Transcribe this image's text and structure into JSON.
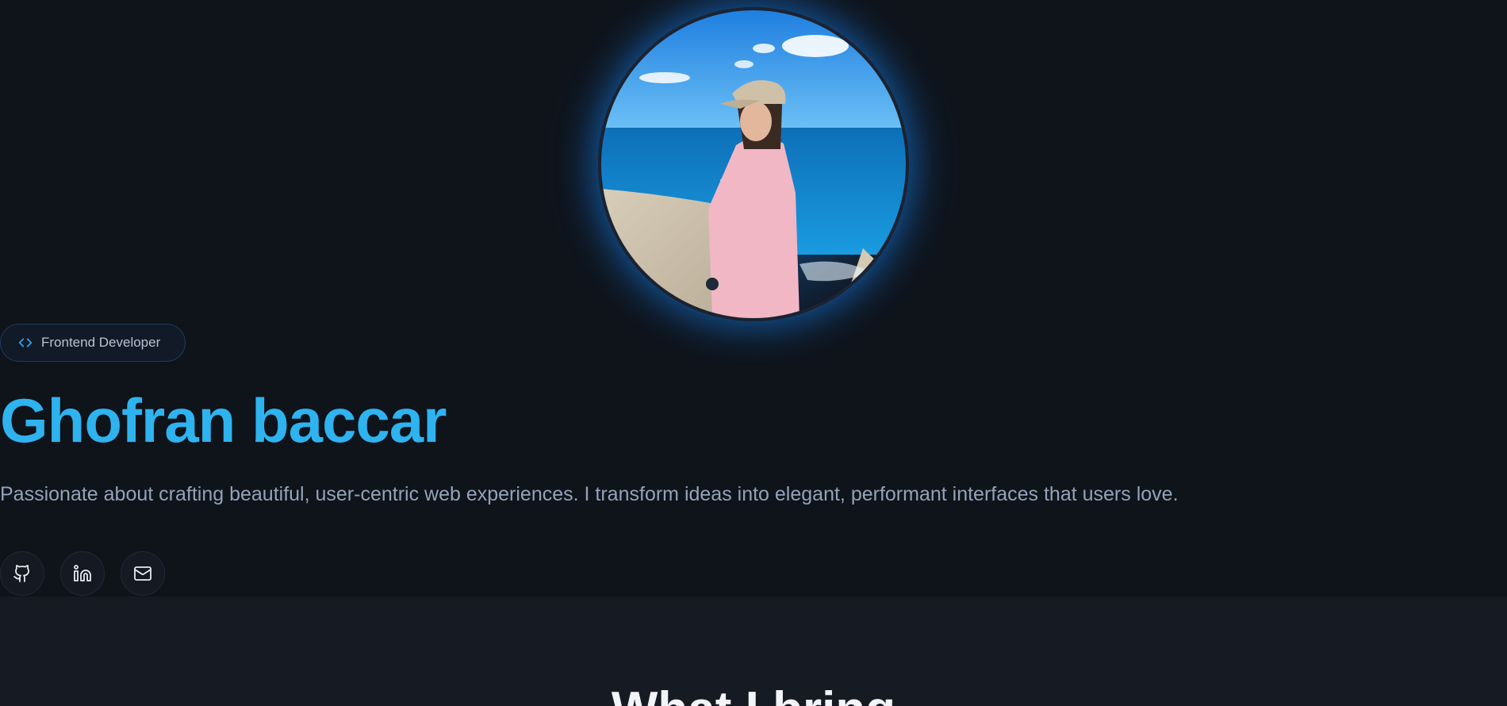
{
  "profile": {
    "photo_alt": "Profile photo"
  },
  "hero": {
    "role_badge": "Frontend Developer",
    "name": "Ghofran baccar",
    "bio": "Passionate about crafting beautiful, user-centric web experiences. I transform ideas into elegant, performant interfaces that users love."
  },
  "socials": [
    {
      "icon": "github-icon",
      "label": "GitHub"
    },
    {
      "icon": "linkedin-icon",
      "label": "LinkedIn"
    },
    {
      "icon": "mail-icon",
      "label": "Email"
    }
  ],
  "next_section": {
    "title": "What I bring"
  },
  "colors": {
    "background": "#0f131a",
    "section_background": "#161a23",
    "accent": "#2eb3ef",
    "muted_text": "#93a3b8"
  }
}
